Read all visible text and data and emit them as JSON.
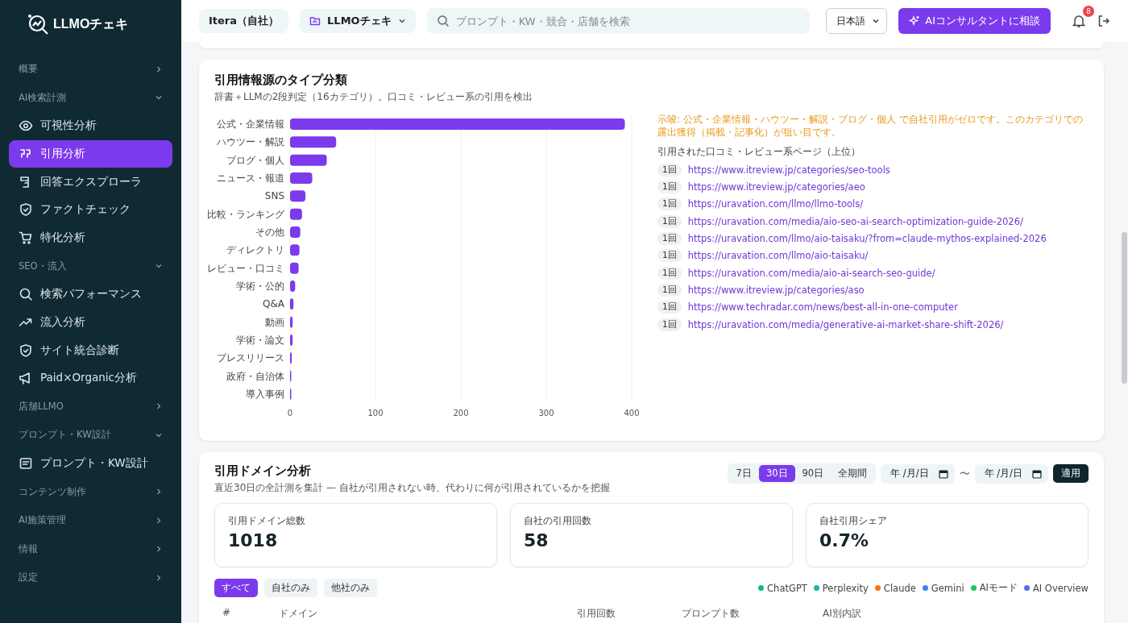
{
  "sidebar": {
    "logo": "LLMOチェキ",
    "sections": [
      {
        "label": "概要",
        "expanded": false
      },
      {
        "label": "AI検索計測",
        "expanded": true,
        "items": [
          {
            "label": "可視性分析",
            "selected": false
          },
          {
            "label": "引用分析",
            "selected": true
          },
          {
            "label": "回答エクスプローラ",
            "selected": false
          },
          {
            "label": "ファクトチェック",
            "selected": false
          },
          {
            "label": "特化分析",
            "selected": false
          }
        ]
      },
      {
        "label": "SEO・流入",
        "expanded": true,
        "items": [
          {
            "label": "検索パフォーマンス",
            "selected": false
          },
          {
            "label": "流入分析",
            "selected": false
          },
          {
            "label": "サイト統合診断",
            "selected": false
          },
          {
            "label": "Paid×Organic分析",
            "selected": false
          }
        ]
      },
      {
        "label": "店舗LLMO",
        "expanded": false
      },
      {
        "label": "プロンプト・KW設計",
        "expanded": true,
        "items": [
          {
            "label": "プロンプト・KW設計",
            "selected": false
          }
        ]
      },
      {
        "label": "コンテンツ制作",
        "expanded": false
      },
      {
        "label": "AI施策管理",
        "expanded": false
      },
      {
        "label": "情報",
        "expanded": false
      },
      {
        "label": "設定",
        "expanded": false
      }
    ]
  },
  "header": {
    "company": "Itera（自社）",
    "project": "LLMOチェキ",
    "search": {
      "placeholder": "プロンプト・KW・競合・店舗を検索"
    },
    "language": "日本語",
    "consult_button": "AIコンサルタントに相談",
    "notifications": "8"
  },
  "type_card": {
    "title": "引用情報源のタイプ分類",
    "subtitle": "辞書＋LLMの2段判定（16カテゴリ）。口コミ・レビュー系の引用を検出",
    "chart_data": {
      "type": "bar",
      "orientation": "horizontal",
      "categories": [
        "公式・企業情報",
        "ハウツー・解説",
        "ブログ・個人",
        "ニュース・報道",
        "SNS",
        "比較・ランキング",
        "その他",
        "ディレクトリ",
        "レビュー・口コミ",
        "学術・公的",
        "Q&A",
        "動画",
        "学術・論文",
        "プレスリリース",
        "政府・自治体",
        "導入事例"
      ],
      "series": [
        {
          "color": "#7c3aed",
          "values": [
            392,
            54,
            43,
            26,
            18,
            14,
            12,
            11,
            10,
            6,
            4,
            3,
            3,
            2,
            1,
            1
          ]
        }
      ],
      "xlim": [
        0,
        400
      ],
      "xticks": [
        0,
        100,
        200,
        300,
        400
      ],
      "grid": true
    },
    "hint": "示唆: 公式・企業情報・ハウツー・解説・ブログ・個人 で自社引用がゼロです。このカテゴリでの露出獲得（掲載・記事化）が狙い目です。",
    "pages_title": "引用された口コミ・レビュー系ページ（上位）",
    "pages": [
      {
        "count": "1回",
        "url": "https://www.itreview.jp/categories/seo-tools"
      },
      {
        "count": "1回",
        "url": "https://www.itreview.jp/categories/aeo"
      },
      {
        "count": "1回",
        "url": "https://uravation.com/llmo/llmo-tools/"
      },
      {
        "count": "1回",
        "url": "https://uravation.com/media/aio-seo-ai-search-optimization-guide-2026/"
      },
      {
        "count": "1回",
        "url": "https://uravation.com/llmo/aio-taisaku/?from=claude-mythos-explained-2026"
      },
      {
        "count": "1回",
        "url": "https://uravation.com/llmo/aio-taisaku/"
      },
      {
        "count": "1回",
        "url": "https://uravation.com/media/aio-ai-search-seo-guide/"
      },
      {
        "count": "1回",
        "url": "https://www.itreview.jp/categories/aso"
      },
      {
        "count": "1回",
        "url": "https://www.techradar.com/news/best-all-in-one-computer"
      },
      {
        "count": "1回",
        "url": "https://uravation.com/media/generative-ai-market-share-shift-2026/"
      }
    ]
  },
  "domain_card": {
    "title": "引用ドメイン分析",
    "subtitle": "直近30日の全計測を集計 — 自社が引用されない時、代わりに何が引用されているかを把握",
    "periods": [
      {
        "label": "7日",
        "selected": false
      },
      {
        "label": "30日",
        "selected": true
      },
      {
        "label": "90日",
        "selected": false
      },
      {
        "label": "全期間",
        "selected": false
      }
    ],
    "date_from": {
      "placeholder": "年 /月/日"
    },
    "range_sep": "〜",
    "date_to": {
      "placeholder": "年 /月/日"
    },
    "apply": "適用",
    "stats": [
      {
        "label": "引用ドメイン総数",
        "value": "1018"
      },
      {
        "label": "自社の引用回数",
        "value": "58"
      },
      {
        "label": "自社引用シェア",
        "value": "0.7%"
      }
    ],
    "filters": [
      {
        "label": "すべて",
        "selected": true
      },
      {
        "label": "自社のみ",
        "selected": false
      },
      {
        "label": "他社のみ",
        "selected": false
      }
    ],
    "legend": [
      {
        "label": "ChatGPT",
        "color": "#10b981"
      },
      {
        "label": "Perplexity",
        "color": "#14b8a6"
      },
      {
        "label": "Claude",
        "color": "#f97316"
      },
      {
        "label": "Gemini",
        "color": "#3b82f6"
      },
      {
        "label": "AIモード",
        "color": "#22c55e"
      },
      {
        "label": "AI Overview",
        "color": "#6366f1"
      }
    ],
    "columns": [
      "#",
      "ドメイン",
      "引用回数",
      "プロンプト数",
      "AI別内訳"
    ]
  }
}
